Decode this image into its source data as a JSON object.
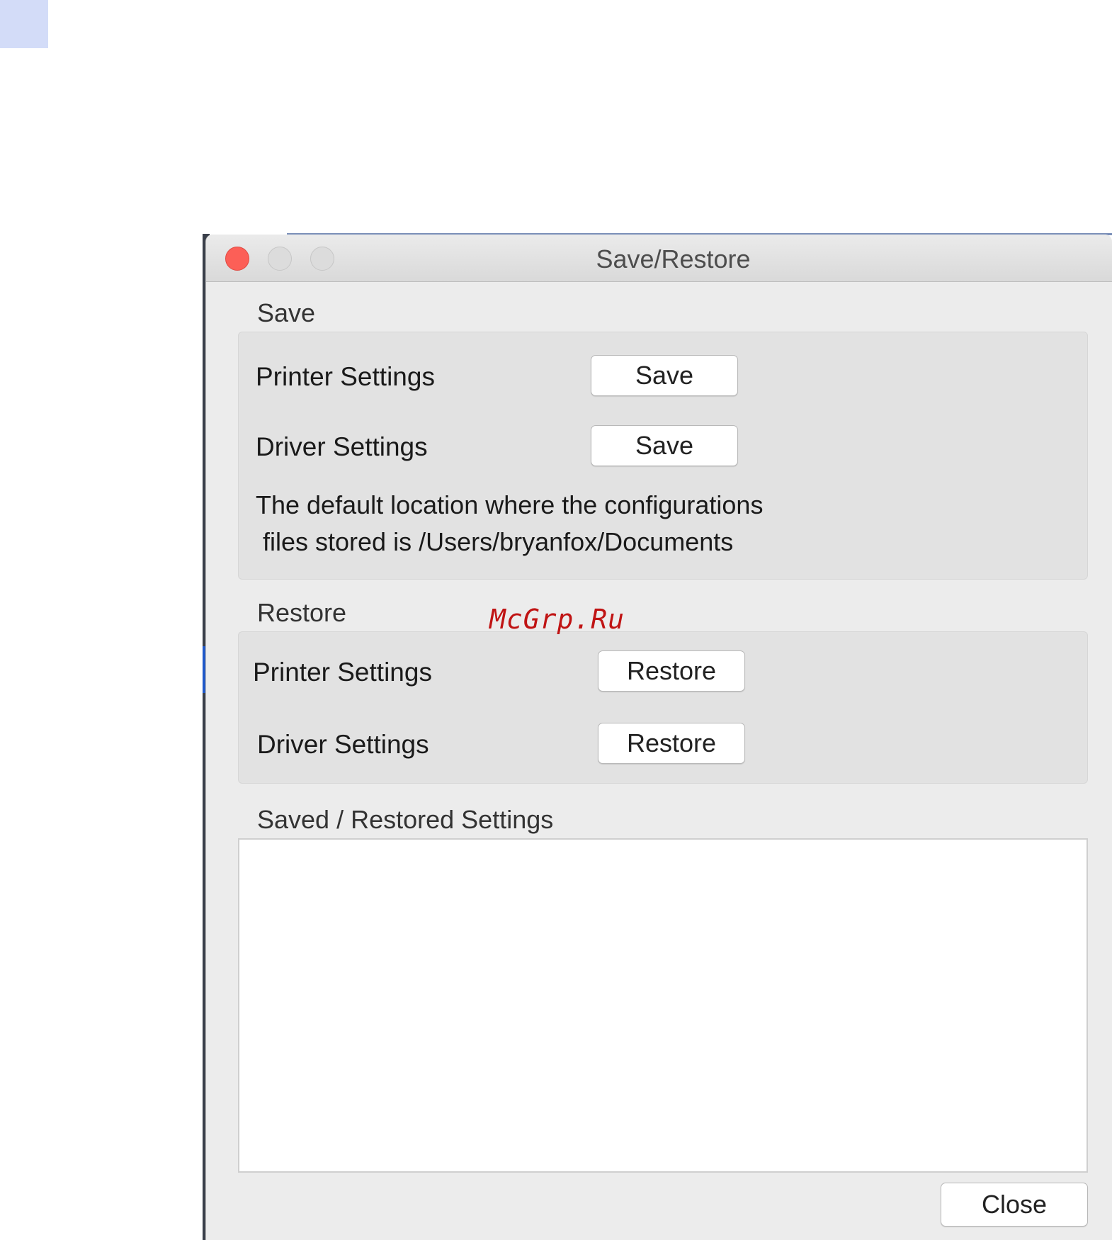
{
  "window": {
    "title": "Save/Restore"
  },
  "save_section": {
    "label": "Save",
    "rows": [
      {
        "label": "Printer Settings",
        "button": "Save"
      },
      {
        "label": "Driver Settings",
        "button": "Save"
      }
    ],
    "note_line1": "The default location where the configurations",
    "note_line2": "files stored is /Users/bryanfox/Documents"
  },
  "restore_section": {
    "label": "Restore",
    "rows": [
      {
        "label": "Printer Settings",
        "button": "Restore"
      },
      {
        "label": "Driver Settings",
        "button": "Restore"
      }
    ]
  },
  "log": {
    "label": "Saved / Restored Settings",
    "content": ""
  },
  "footer": {
    "close_label": "Close"
  },
  "watermark": "McGrp.Ru",
  "colors": {
    "close_button": "#fc5f57",
    "watermark": "#c01414",
    "window_bg": "#ececec",
    "group_bg": "#e2e2e2"
  }
}
